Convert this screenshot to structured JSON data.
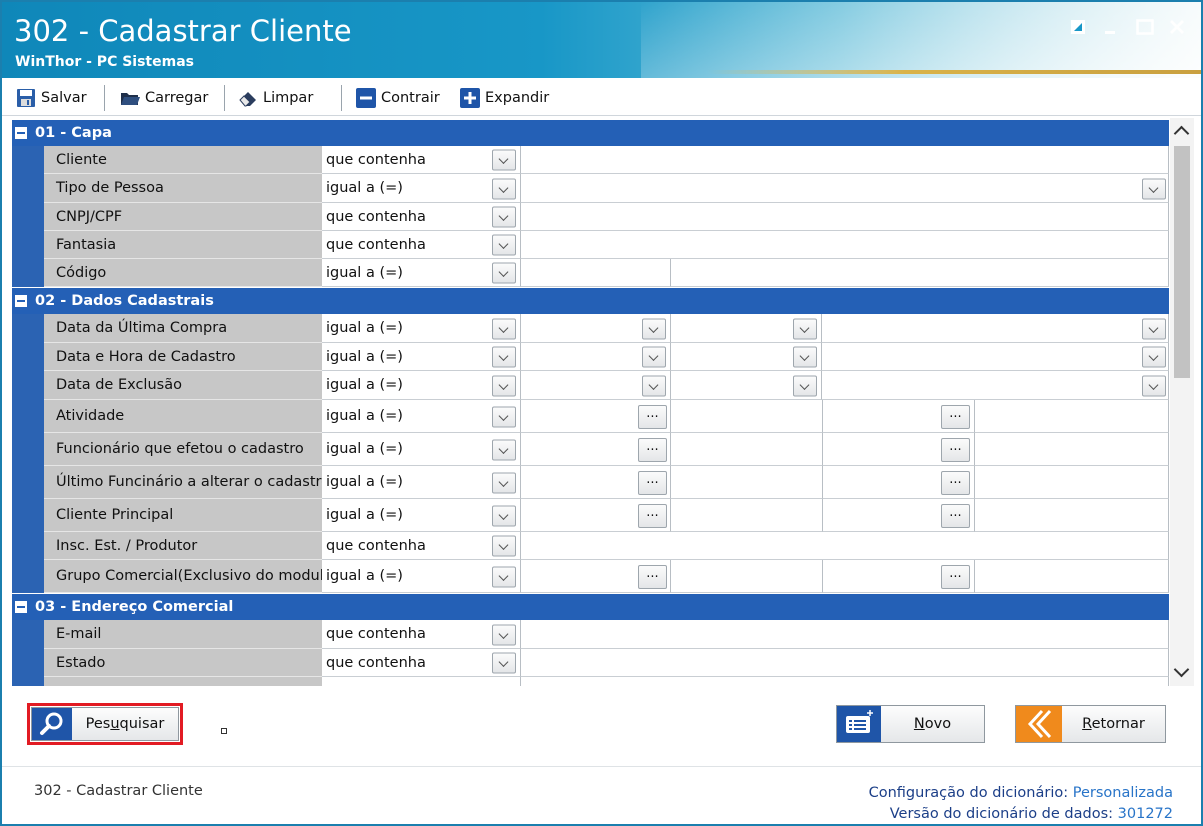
{
  "window": {
    "title": "302 - Cadastrar Cliente",
    "subtitle": "WinThor - PC Sistemas",
    "controls": [
      "restore",
      "minimize",
      "maximize",
      "close"
    ]
  },
  "toolbar": {
    "save": "Salvar",
    "load": "Carregar",
    "clear": "Limpar",
    "collapse": "Contrair",
    "expand": "Expandir"
  },
  "sections": [
    {
      "title": "01 - Capa",
      "rows": [
        {
          "label": "Cliente",
          "operator": "que contenha"
        },
        {
          "label": "Tipo de Pessoa",
          "operator": "igual a (=)"
        },
        {
          "label": "CNPJ/CPF",
          "operator": "que contenha"
        },
        {
          "label": "Fantasia",
          "operator": "que contenha"
        },
        {
          "label": "Código",
          "operator": "igual a (=)"
        }
      ]
    },
    {
      "title": "02 - Dados Cadastrais",
      "rows": [
        {
          "label": "Data da Última Compra",
          "operator": "igual a (=)"
        },
        {
          "label": "Data e Hora de Cadastro",
          "operator": "igual a (=)"
        },
        {
          "label": "Data de Exclusão",
          "operator": "igual a (=)"
        },
        {
          "label": "Atividade",
          "operator": "igual a (=)"
        },
        {
          "label": "Funcionário que efetou o cadastro",
          "operator": "igual a (=)"
        },
        {
          "label": "Último Funcinário a alterar o cadastro",
          "operator": "igual a (=)"
        },
        {
          "label": "Cliente Principal",
          "operator": "igual a (=)"
        },
        {
          "label": "Insc. Est. / Produtor",
          "operator": "que contenha"
        },
        {
          "label": "Grupo Comercial(Exclusivo do modulo",
          "operator": "igual a (=)"
        }
      ]
    },
    {
      "title": "03 - Endereço Comercial",
      "rows": [
        {
          "label": "E-mail",
          "operator": "que contenha"
        },
        {
          "label": "Estado",
          "operator": "que contenha"
        }
      ]
    }
  ],
  "buttons": {
    "search": "Pesquisar",
    "search_underline": "u",
    "new": "Novo",
    "new_underline": "N",
    "back": "Retornar",
    "back_underline": "R"
  },
  "status": {
    "screen": "302 - Cadastrar Cliente",
    "dict_config_label": "Configuração do dicionário:",
    "dict_config_value": "Personalizada",
    "dict_version_label": "Versão do dicionário de dados:",
    "dict_version_value": "301272"
  },
  "colors": {
    "section_header": "#2460b6",
    "label_bg": "#c7c7c7",
    "highlight": "#e21b23",
    "title_bar": "#1897c7"
  }
}
